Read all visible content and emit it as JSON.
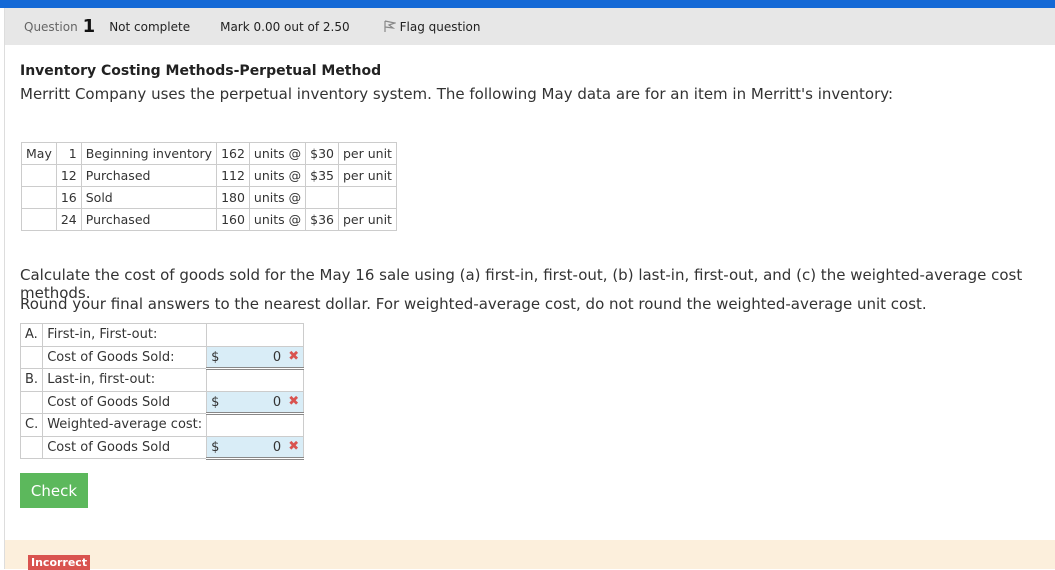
{
  "header": {
    "question_label": "Question",
    "question_number": "1",
    "status": "Not complete",
    "mark": "Mark 0.00 out of 2.50",
    "flag": "Flag question"
  },
  "title": "Inventory Costing Methods-Perpetual Method",
  "intro": "Merritt Company uses the perpetual inventory system. The following May data are for an item in Merritt's inventory:",
  "inventory": [
    [
      "May",
      "1",
      "Beginning inventory",
      "162",
      "units @",
      "$30",
      "per unit"
    ],
    [
      "",
      "12",
      "Purchased",
      "112",
      "units @",
      "$35",
      "per unit"
    ],
    [
      "",
      "16",
      "Sold",
      "180",
      "units @",
      "",
      ""
    ],
    [
      "",
      "24",
      "Purchased",
      "160",
      "units @",
      "$36",
      "per unit"
    ]
  ],
  "instructions": "Calculate the cost of goods sold for the May 16 sale using (a) first-in, first-out, (b) last-in, first-out, and (c) the weighted-average cost methods.",
  "rounding": "Round your final answers to the nearest dollar. For weighted-average cost, do not round the weighted-average unit cost.",
  "answers": [
    {
      "letter": "A.",
      "heading": "First-in, First-out:",
      "label": "Cost of Goods Sold:",
      "currency": "$",
      "value": "0",
      "mark": "✖"
    },
    {
      "letter": "B.",
      "heading": "Last-in, first-out:",
      "label": "Cost of Goods Sold",
      "currency": "$",
      "value": "0",
      "mark": "✖"
    },
    {
      "letter": "C.",
      "heading": "Weighted-average cost:",
      "label": "Cost of Goods Sold",
      "currency": "$",
      "value": "0",
      "mark": "✖"
    }
  ],
  "check_label": "Check",
  "feedback_badge": "Incorrect",
  "colors": {
    "topbar": "#1469d6",
    "check": "#5cb85c",
    "incorrect": "#d9534f",
    "input_bg": "#d9edf7"
  }
}
